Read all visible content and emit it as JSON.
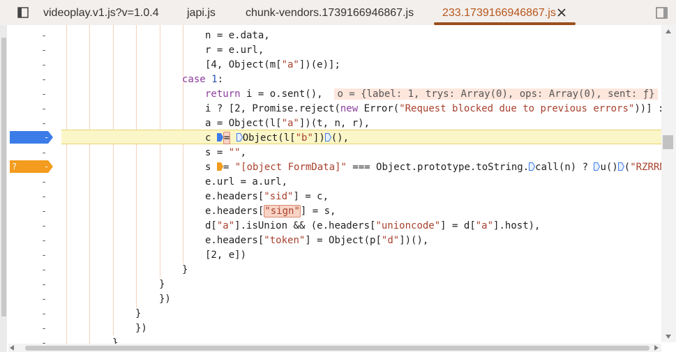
{
  "tabs": [
    {
      "label": "videoplay.v1.js?v=1.0.4",
      "active": false
    },
    {
      "label": "japi.js",
      "active": false
    },
    {
      "label": "chunk-vendors.1739166946867.js",
      "active": false
    },
    {
      "label": "233.1739166946867.js",
      "active": true
    }
  ],
  "icons": {
    "nav": "navigator-toggle-icon",
    "close": "close-icon",
    "panel": "sidebar-toggle-icon"
  },
  "colors": {
    "active_tab": "#b7561a",
    "breakpoint_blue": "#3b7ce8",
    "breakpoint_orange": "#f39c1f",
    "highlight_line": "#fbf6c8"
  },
  "breakpoints": {
    "conditional_label": "?"
  },
  "gutter_marker": "-",
  "code": {
    "l1": "n = e.data,",
    "l2": "r = e.url,",
    "l3_a": "[4, Object(m[",
    "l3_s": "\"a\"",
    "l3_b": "])(e)];",
    "l4_kw": "case",
    "l4_num": " 1",
    "l4_b": ":",
    "l5_kw": "return",
    "l5_b": " i = o.sent(),",
    "l5_inline": "o = {label: 1, trys: Array(0), ops: Array(0), sent: ƒ}",
    "l6_a": "i ? [2, Promise.reject(",
    "l6_kw": "new",
    "l6_b": " Error(",
    "l6_s": "\"Request blocked due to previous errors\"",
    "l6_c": "))] :",
    "l7_a": "a = Object(l[",
    "l7_s": "\"a\"",
    "l7_b": "])(t, n, r),",
    "l8_a": "c ",
    "l8_eq": "=",
    "l8_b": "Object(l[",
    "l8_s": "\"b\"",
    "l8_c": "])",
    "l8_d": "(),",
    "l9_a": "s = ",
    "l9_s": "\"\"",
    "l9_b": ",",
    "l10_a": "s ",
    "l10_eq": "=",
    "l10_s": " \"[object FormData]\"",
    "l10_b": " === Object.prototype.toString.",
    "l10_c": "call(n) ? ",
    "l10_d": "u()",
    "l10_e": "(",
    "l10_s2": "\"RZRRN",
    "l11": "e.url = a.url,",
    "l12_a": "e.headers[",
    "l12_s": "\"sid\"",
    "l12_b": "] = c,",
    "l13_a": "e.headers[",
    "l13_s": "\"sign\"",
    "l13_b": "] = s,",
    "l14_a": "d[",
    "l14_s": "\"a\"",
    "l14_b": "].isUnion && (e.headers[",
    "l14_s2": "\"unioncode\"",
    "l14_c": "] = d[",
    "l14_s3": "\"a\"",
    "l14_d": "].host),",
    "l15_a": "e.headers[",
    "l15_s": "\"token\"",
    "l15_b": "] = Object(p[",
    "l15_s2": "\"d\"",
    "l15_c": "])(),",
    "l16": "[2, e])",
    "l17": "}",
    "l18": "}",
    "l19": "})",
    "l20": "}",
    "l21": "})",
    "l22": "}"
  }
}
